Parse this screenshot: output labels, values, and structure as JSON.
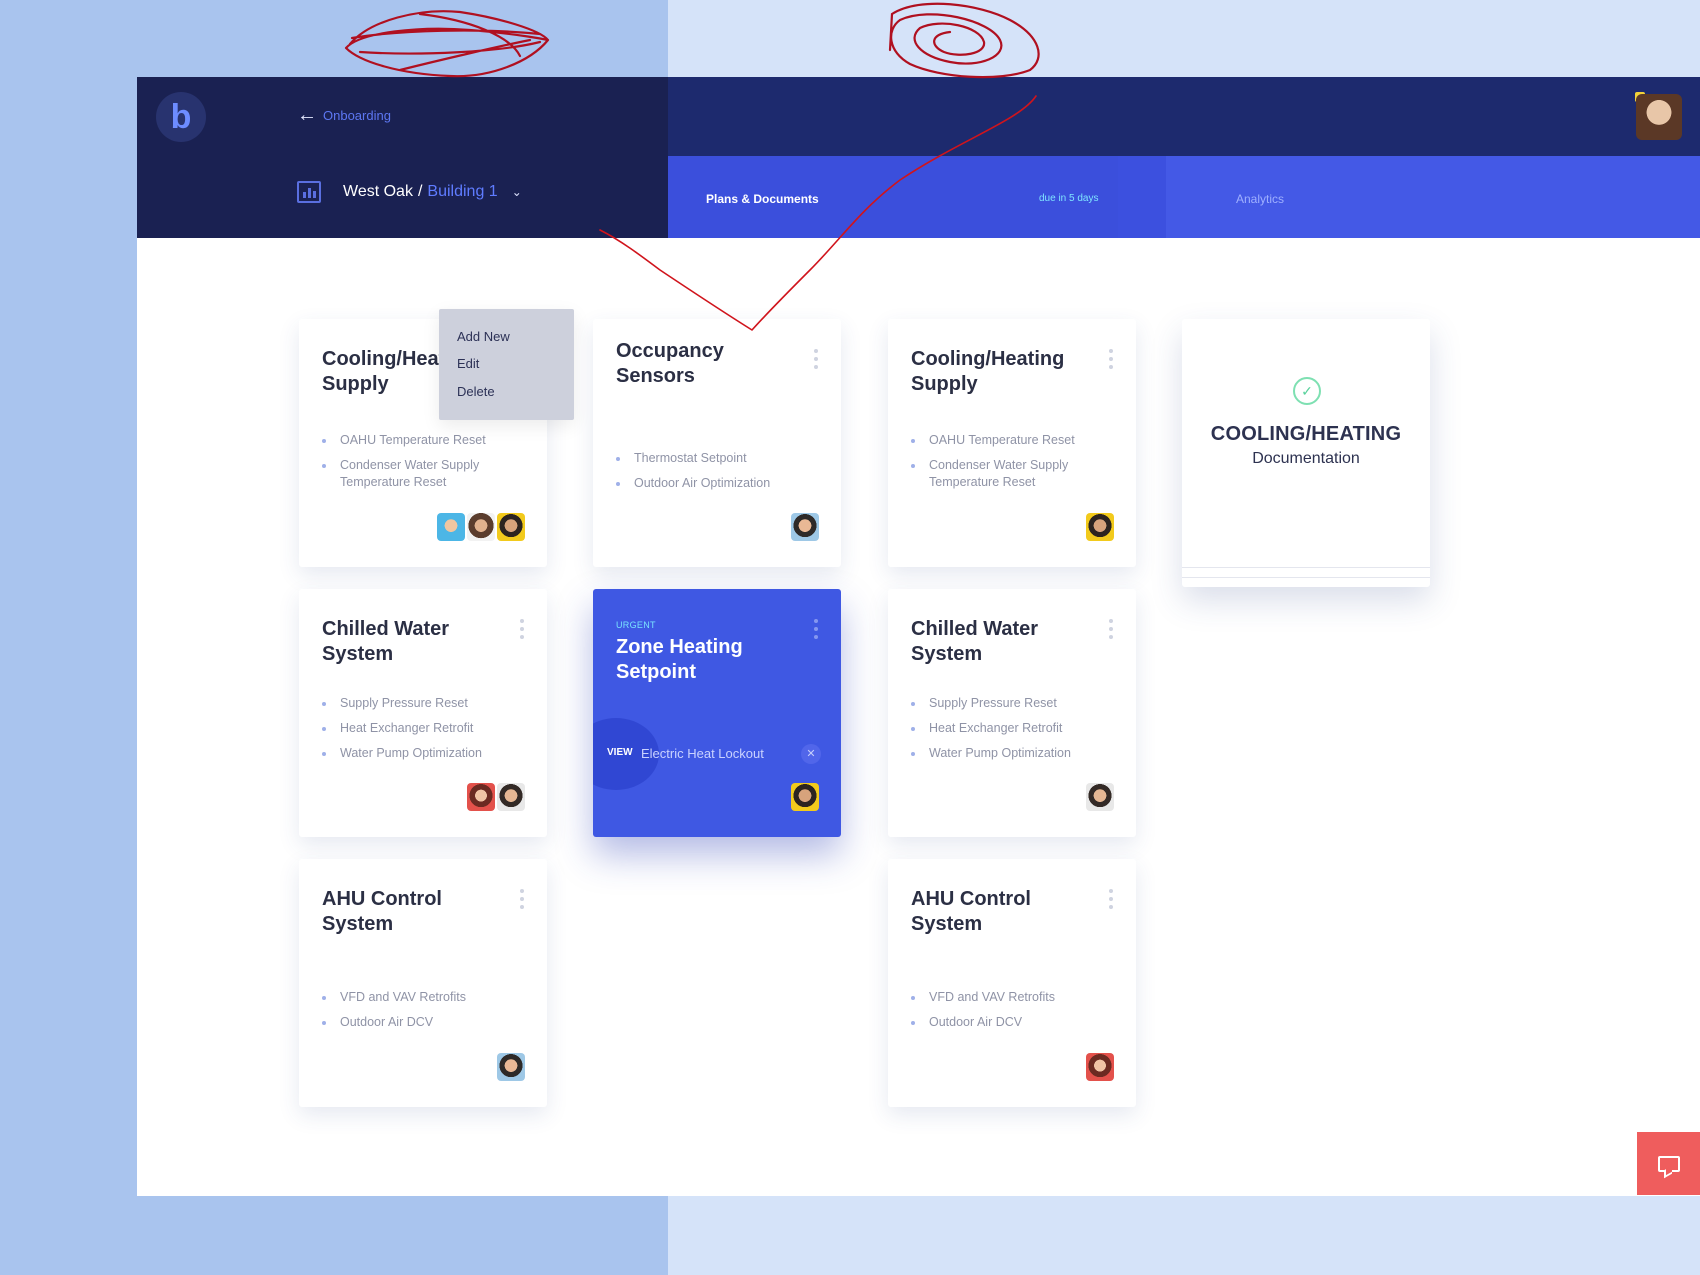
{
  "header": {
    "logo_letter": "b",
    "back_label": "Onboarding",
    "breadcrumb": {
      "site": "West Oak",
      "separator": "/",
      "building": "Building 1"
    }
  },
  "tabs": {
    "plans": "Plans & Documents",
    "due": "due in 5 days",
    "analytics": "Analytics"
  },
  "context_menu": {
    "items": [
      "Add New",
      "Edit",
      "Delete"
    ]
  },
  "cards": [
    {
      "title": "Cooling/Heating Supply",
      "items": [
        "OAHU Temperature Reset",
        "Condenser Water Supply Temperature Reset"
      ]
    },
    {
      "title": "Occupancy Sensors",
      "items": [
        "Thermostat Setpoint",
        "Outdoor Air Optimization"
      ]
    },
    {
      "title": "Cooling/Heating Supply",
      "items": [
        "OAHU Temperature Reset",
        "Condenser Water Supply Temperature Reset"
      ]
    },
    {
      "title": "Chilled Water System",
      "items": [
        "Supply Pressure Reset",
        "Heat Exchanger Retrofit",
        "Water Pump Optimization"
      ]
    },
    {
      "tag": "URGENT",
      "title": "Zone Heating Setpoint",
      "view": "VIEW",
      "view_text": "Electric Heat Lockout",
      "close": "✕"
    },
    {
      "title": "Chilled Water System",
      "items": [
        "Supply Pressure Reset",
        "Heat Exchanger Retrofit",
        "Water Pump Optimization"
      ]
    },
    {
      "title": "AHU Control System",
      "items": [
        "VFD and VAV Retrofits",
        "Outdoor Air DCV"
      ]
    },
    {
      "title": "AHU Control System",
      "items": [
        "VFD and VAV Retrofits",
        "Outdoor Air DCV"
      ]
    }
  ],
  "documentation_card": {
    "heading": "COOLING/HEATING",
    "subheading": "Documentation",
    "icon": "check-circle-icon"
  },
  "colors": {
    "nav_dark": "#1a2152",
    "accent": "#4459e6",
    "urgent_card": "#3f58e3",
    "chat": "#ef5d5d",
    "annotation": "#c0101a"
  }
}
